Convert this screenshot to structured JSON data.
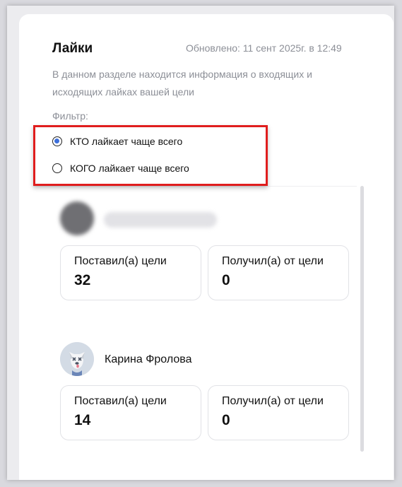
{
  "header": {
    "title": "Лайки",
    "updated": "Обновлено: 11 сент 2025г. в 12:49"
  },
  "description": "В данном разделе находится информация о входящих и исходящих лайках вашей цели",
  "filter": {
    "label": "Фильтр:",
    "options": [
      {
        "label": "КТО лайкает чаще всего",
        "checked": true
      },
      {
        "label": "КОГО лайкает чаще всего",
        "checked": false
      }
    ],
    "accent": "#3d6fdb"
  },
  "people": [
    {
      "name": "",
      "blurred": true,
      "given_label": "Поставил(а) цели",
      "given_value": "32",
      "received_label": "Получил(а) от цели",
      "received_value": "0"
    },
    {
      "name": "Карина Фролова",
      "avatar": "dog-avatar-icon",
      "given_label": "Поставил(а) цели",
      "given_value": "14",
      "received_label": "Получил(а) от цели",
      "received_value": "0"
    }
  ]
}
